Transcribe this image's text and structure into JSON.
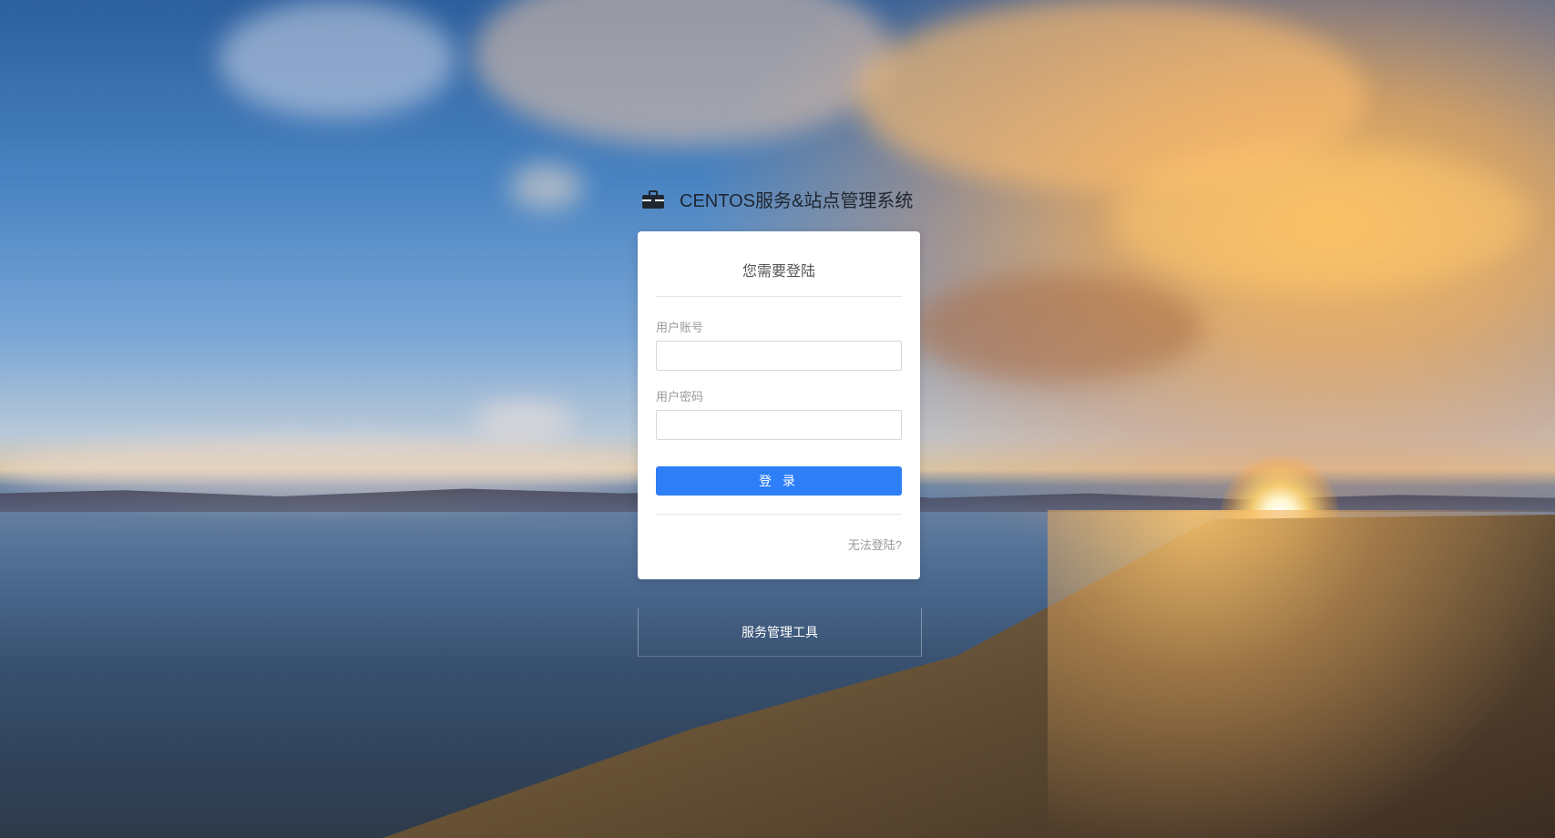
{
  "brand": {
    "icon": "briefcase-icon",
    "title": "CENTOS服务&站点管理系统"
  },
  "login_card": {
    "title": "您需要登陆",
    "username": {
      "label": "用户账号",
      "value": "",
      "placeholder": ""
    },
    "password": {
      "label": "用户密码",
      "value": "",
      "placeholder": ""
    },
    "login_button": "登 录",
    "cant_login_link": "无法登陆?"
  },
  "footer": {
    "tool_link": "服务管理工具"
  },
  "colors": {
    "primary": "#2d7ef7",
    "card_bg": "#ffffff",
    "label": "#9a9a9a"
  }
}
